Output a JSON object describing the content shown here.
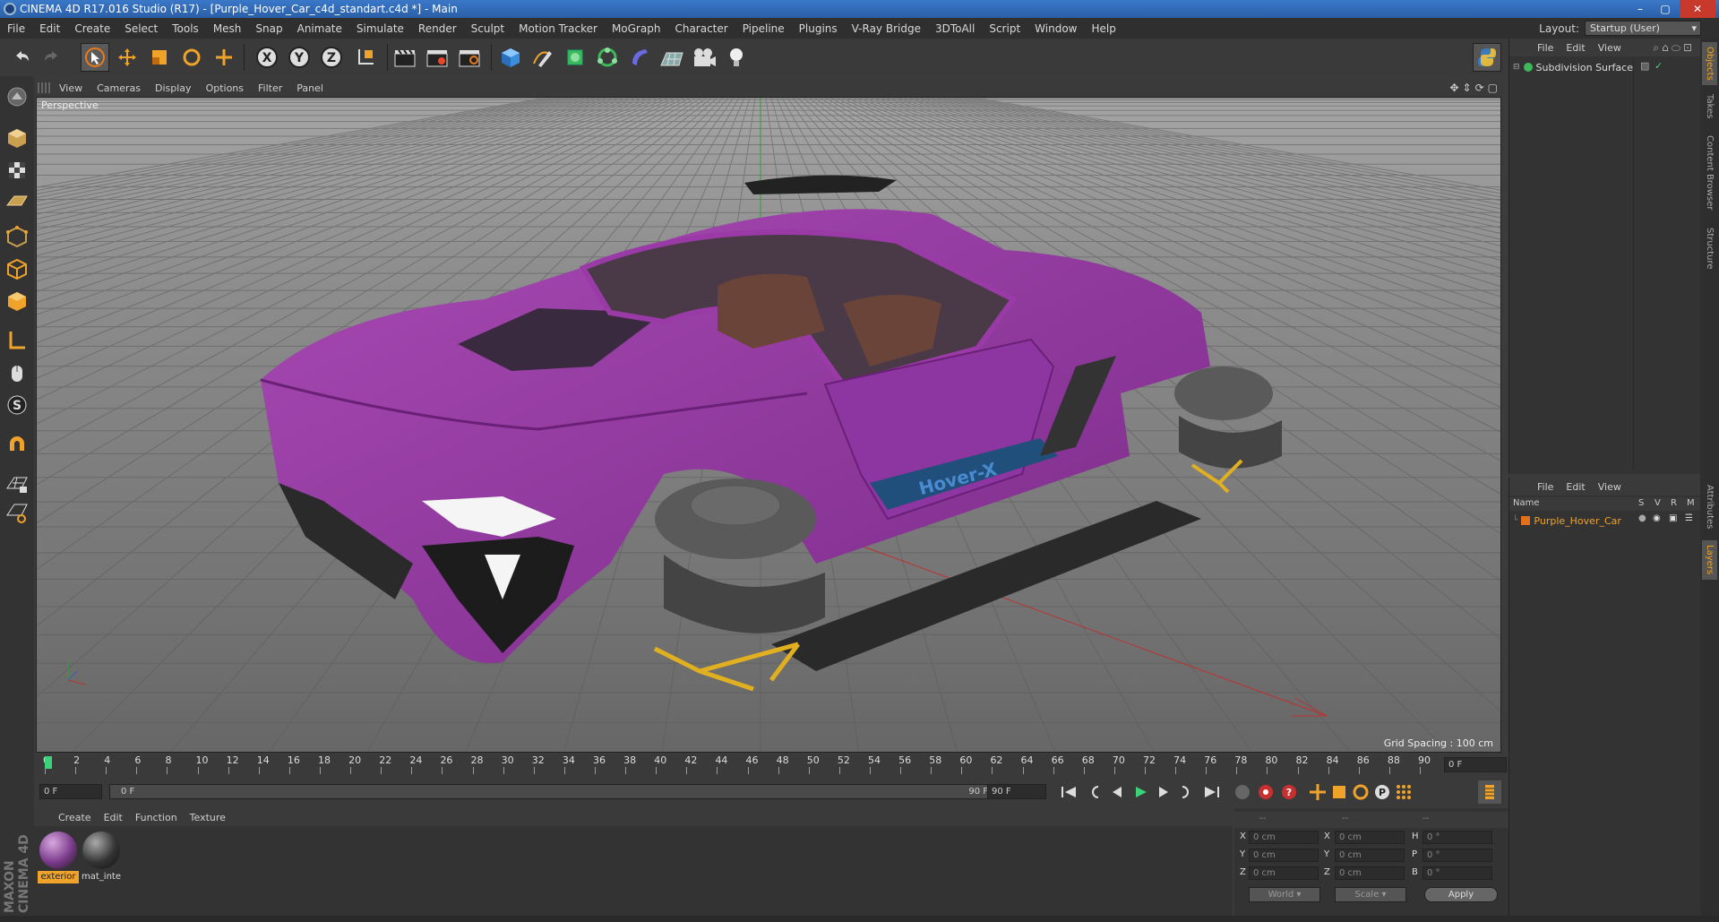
{
  "window": {
    "title": "CINEMA 4D R17.016 Studio (R17) - [Purple_Hover_Car_c4d_standart.c4d *] - Main",
    "min": "–",
    "max": "▢",
    "close": "✕"
  },
  "menubar": {
    "items": [
      "File",
      "Edit",
      "Create",
      "Select",
      "Tools",
      "Mesh",
      "Snap",
      "Animate",
      "Simulate",
      "Render",
      "Sculpt",
      "Motion Tracker",
      "MoGraph",
      "Character",
      "Pipeline",
      "Plugins",
      "V-Ray Bridge",
      "3DToAll",
      "Script",
      "Window",
      "Help"
    ],
    "layout_label": "Layout:",
    "layout_value": "Startup (User)"
  },
  "viewport": {
    "menu": [
      "View",
      "Cameras",
      "Display",
      "Options",
      "Filter",
      "Panel"
    ],
    "camera_label": "Perspective",
    "grid_spacing": "Grid Spacing : 100 cm",
    "car_label": "Hover-X",
    "colors": {
      "car": "#9a3aa6",
      "floor": "#6f6f6f",
      "sky": "#a9a9a9"
    }
  },
  "timeline": {
    "ticks": [
      "0",
      "2",
      "4",
      "6",
      "8",
      "10",
      "12",
      "14",
      "16",
      "18",
      "20",
      "22",
      "24",
      "26",
      "28",
      "30",
      "32",
      "34",
      "36",
      "38",
      "40",
      "42",
      "44",
      "46",
      "48",
      "50",
      "52",
      "54",
      "56",
      "58",
      "60",
      "62",
      "64",
      "66",
      "68",
      "70",
      "72",
      "74",
      "76",
      "78",
      "80",
      "82",
      "84",
      "86",
      "88",
      "90"
    ],
    "current_frame": "0 F"
  },
  "transport": {
    "start": "0 F",
    "range_start": "0 F",
    "range_end": "90 F",
    "end": "90 F"
  },
  "materials": {
    "menu": [
      "Create",
      "Edit",
      "Function",
      "Texture"
    ],
    "items": [
      {
        "name": "exterior",
        "selected": true
      },
      {
        "name": "mat_inte",
        "selected": false
      }
    ]
  },
  "coordinates": {
    "header": [
      "--",
      "--",
      "--"
    ],
    "rows": [
      {
        "a": "X",
        "av": "0 cm",
        "b": "X",
        "bv": "0 cm",
        "c": "H",
        "cv": "0 °"
      },
      {
        "a": "Y",
        "av": "0 cm",
        "b": "Y",
        "bv": "0 cm",
        "c": "P",
        "cv": "0 °"
      },
      {
        "a": "Z",
        "av": "0 cm",
        "b": "Z",
        "bv": "0 cm",
        "c": "B",
        "cv": "0 °"
      }
    ],
    "space": "World",
    "mode": "Scale",
    "apply": "Apply"
  },
  "objects": {
    "menu": [
      "File",
      "Edit",
      "View"
    ],
    "items": [
      {
        "name": "Subdivision Surface"
      }
    ]
  },
  "layers": {
    "menu": [
      "File",
      "Edit",
      "View"
    ],
    "columns": [
      "Name",
      "S",
      "V",
      "R",
      "M"
    ],
    "items": [
      {
        "name": "Purple_Hover_Car"
      }
    ]
  },
  "side_tabs": [
    "Objects",
    "Takes",
    "Content Browser",
    "Structure",
    "Attributes",
    "Layers"
  ],
  "brand": "MAXON CINEMA 4D"
}
